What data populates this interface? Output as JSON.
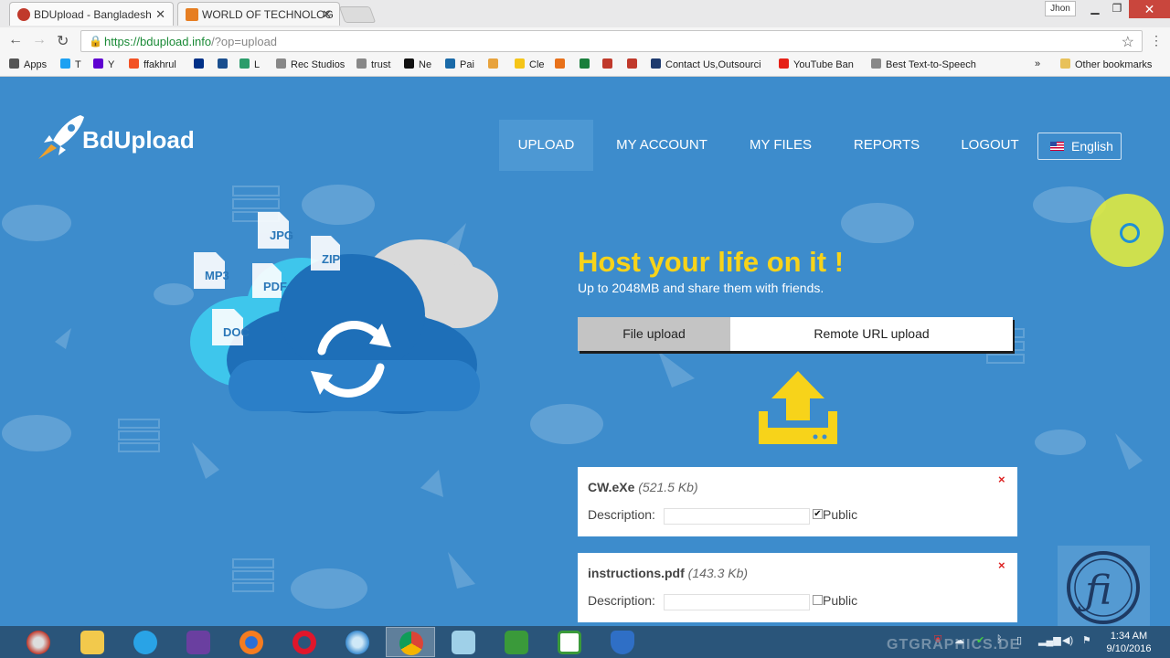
{
  "browser": {
    "tabs": [
      {
        "title": "BDUpload - Bangladesh",
        "favicon_color": "#c0392b"
      },
      {
        "title": "WORLD OF TECHNOLOG",
        "favicon_color": "#e67e22"
      }
    ],
    "user": "Jhon",
    "url_host": "https://bdupload.info",
    "url_path": "/?op=upload",
    "bookmarks": [
      {
        "label": "Apps",
        "color": "#555"
      },
      {
        "label": "T",
        "color": "#1da1f2"
      },
      {
        "label": "Y",
        "color": "#5f01d1"
      },
      {
        "label": "ffakhrul",
        "color": "#f35325"
      },
      {
        "label": "",
        "color": "#003087"
      },
      {
        "label": "",
        "color": "#1a4f8f"
      },
      {
        "label": "L",
        "color": "#2b9c6b"
      },
      {
        "label": "Rec Studios",
        "color": "#888"
      },
      {
        "label": "trust",
        "color": "#888"
      },
      {
        "label": "Ne",
        "color": "#111"
      },
      {
        "label": "Pai",
        "color": "#1a6aa8"
      },
      {
        "label": "",
        "color": "#e8a33d"
      },
      {
        "label": "Cle",
        "color": "#f5c518"
      },
      {
        "label": "",
        "color": "#e8711a"
      },
      {
        "label": "",
        "color": "#1a7f3c"
      },
      {
        "label": "",
        "color": "#c0392b"
      },
      {
        "label": "",
        "color": "#c0392b"
      },
      {
        "label": "Contact Us,Outsourci",
        "color": "#1d3a6e"
      },
      {
        "label": "YouTube Ban",
        "color": "#e62117"
      },
      {
        "label": "Best Text-to-Speech",
        "color": "#888"
      }
    ],
    "bookmarks_overflow": "»",
    "other_bookmarks": "Other bookmarks"
  },
  "site": {
    "logo": "BdUpload",
    "nav": [
      "UPLOAD",
      "MY ACCOUNT",
      "MY FILES",
      "REPORTS",
      "LOGOUT"
    ],
    "language": "English",
    "headline": "Host your life on it !",
    "subline": "Up to 2048MB and share them with friends.",
    "hero_file_types": [
      "JPG",
      "ZIP",
      "MP3",
      "PDF",
      "DOC"
    ],
    "upload_tabs": [
      "File upload",
      "Remote URL upload"
    ],
    "active_upload_tab": "File upload",
    "files": [
      {
        "name": "CW.eXe",
        "size": "(521.5 Kb)",
        "description_label": "Description:",
        "public_label": "Public",
        "public_checked": true
      },
      {
        "name": "instructions.pdf",
        "size": "(143.3 Kb)",
        "description_label": "Description:",
        "public_label": "Public",
        "public_checked": false
      }
    ],
    "remove_symbol": "×"
  },
  "taskbar": {
    "apps": [
      "media-player",
      "file-explorer",
      "internet-explorer",
      "visual-studio",
      "firefox",
      "opera",
      "safari",
      "chrome",
      "notepad",
      "camtasia-recorder",
      "camtasia-studio",
      "security-shield"
    ],
    "active_app": "chrome",
    "time": "1:34 AM",
    "date": "9/10/2016",
    "watermark": "GTGRAPHICS.DE"
  }
}
